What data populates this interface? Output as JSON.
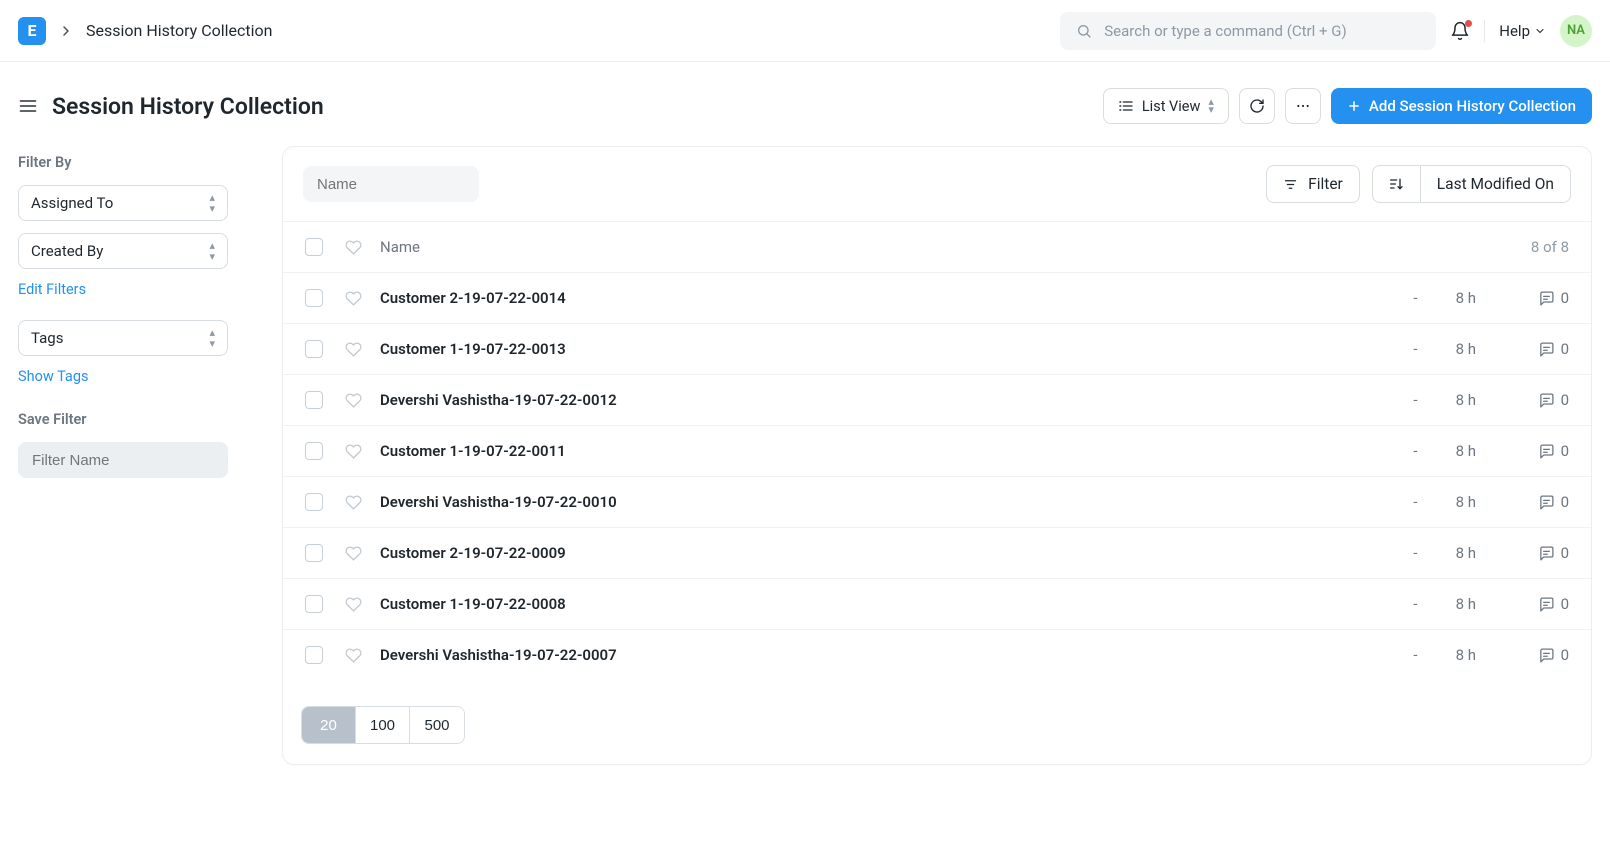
{
  "breadcrumb": {
    "title": "Session History Collection"
  },
  "navbar": {
    "logo_letter": "E",
    "search_placeholder": "Search or type a command (Ctrl + G)",
    "help_label": "Help",
    "avatar_initials": "NA"
  },
  "page": {
    "title": "Session History Collection",
    "view_label": "List View",
    "add_label": "Add Session History Collection"
  },
  "sidebar": {
    "filter_by_label": "Filter By",
    "assigned_to_label": "Assigned To",
    "created_by_label": "Created By",
    "edit_filters_label": "Edit Filters",
    "tags_label": "Tags",
    "show_tags_label": "Show Tags",
    "save_filter_label": "Save Filter",
    "filter_name_placeholder": "Filter Name"
  },
  "table": {
    "name_placeholder": "Name",
    "filter_label": "Filter",
    "sort_label": "Last Modified On",
    "header_name": "Name",
    "count_text": "8 of 8",
    "rows": [
      {
        "name": "Customer 2-19-07-22-0014",
        "status": "-",
        "time": "8 h",
        "comments": "0"
      },
      {
        "name": "Customer 1-19-07-22-0013",
        "status": "-",
        "time": "8 h",
        "comments": "0"
      },
      {
        "name": "Devershi Vashistha-19-07-22-0012",
        "status": "-",
        "time": "8 h",
        "comments": "0"
      },
      {
        "name": "Customer 1-19-07-22-0011",
        "status": "-",
        "time": "8 h",
        "comments": "0"
      },
      {
        "name": "Devershi Vashistha-19-07-22-0010",
        "status": "-",
        "time": "8 h",
        "comments": "0"
      },
      {
        "name": "Customer 2-19-07-22-0009",
        "status": "-",
        "time": "8 h",
        "comments": "0"
      },
      {
        "name": "Customer 1-19-07-22-0008",
        "status": "-",
        "time": "8 h",
        "comments": "0"
      },
      {
        "name": "Devershi Vashistha-19-07-22-0007",
        "status": "-",
        "time": "8 h",
        "comments": "0"
      }
    ]
  },
  "pagination": {
    "sizes": [
      "20",
      "100",
      "500"
    ],
    "active": "20"
  }
}
